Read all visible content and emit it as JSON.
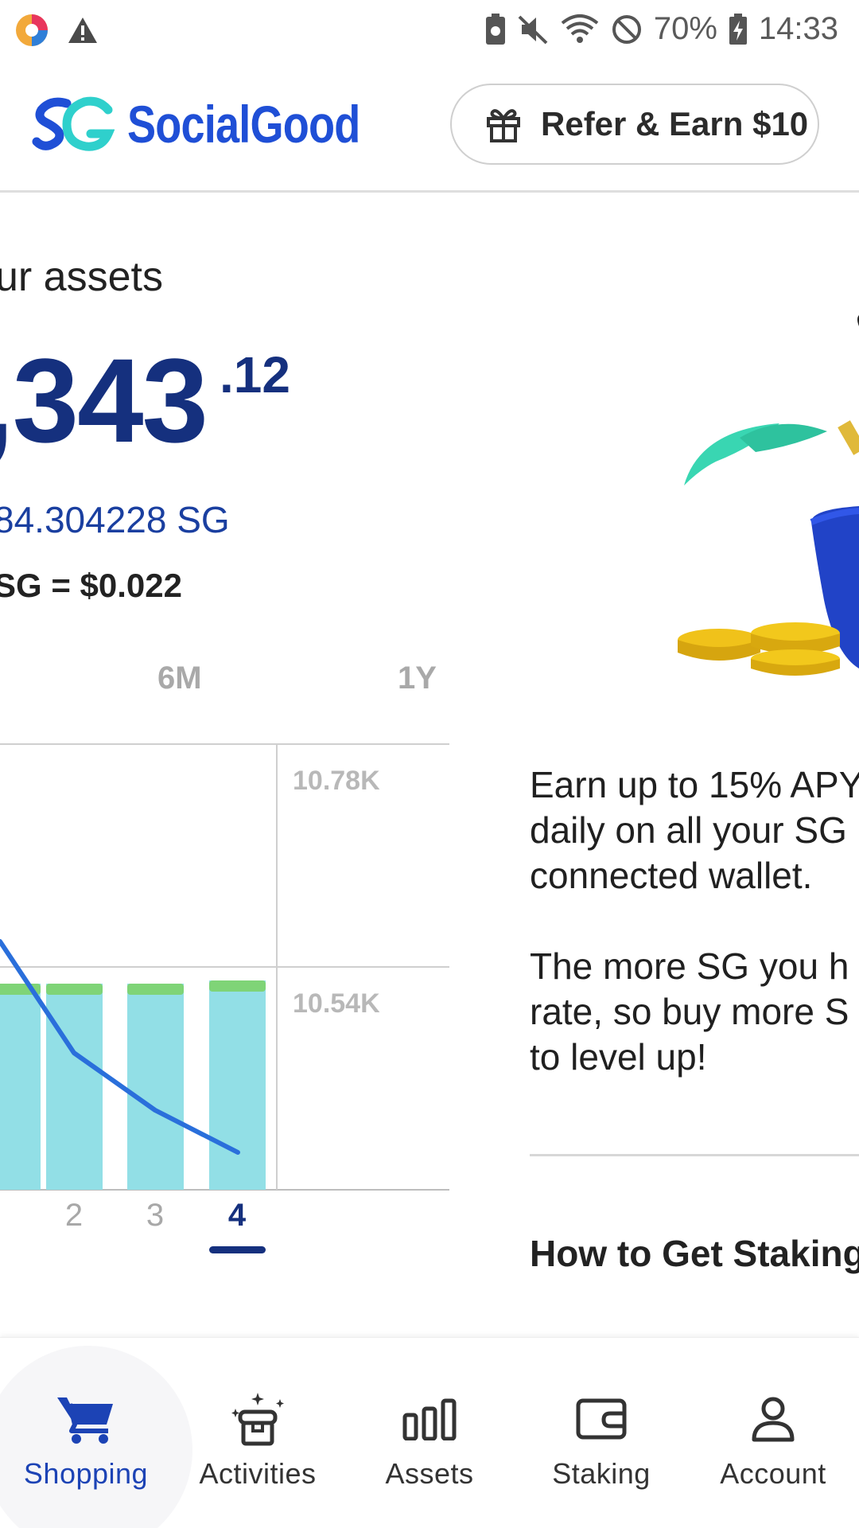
{
  "status_bar": {
    "battery_percent": "70%",
    "time": "14:33",
    "icons": [
      "app-notification-icon",
      "warning-icon",
      "battery-saver-icon",
      "mute-icon",
      "wifi-icon",
      "do-not-disturb-icon",
      "battery-charging-icon"
    ]
  },
  "header": {
    "brand": "SocialGood",
    "refer_label": "Refer & Earn $10",
    "brand_color": "#1f4fd6"
  },
  "assets_card": {
    "title": "ur assets",
    "balance_main": ",343",
    "balance_cents": ".12",
    "sg_amount": "84.304228 SG",
    "sg_rate": "SG = $0.022",
    "range_tabs": [
      "6M",
      "1Y"
    ],
    "accent_color": "#15307e"
  },
  "chart_data": {
    "type": "bar",
    "categories": [
      "",
      "2",
      "3",
      "4"
    ],
    "selected_category": "4",
    "y_tick_labels": [
      "10.78K",
      "10.54K"
    ],
    "series": [
      {
        "type": "bar",
        "color": "#92dfe6",
        "cap_color": "#7fd477"
      },
      {
        "type": "line",
        "color": "#2a6fdb"
      }
    ]
  },
  "staking_card": {
    "paragraph1_lines": [
      "Earn up to 15% APY",
      "daily on all your SG",
      "connected wallet."
    ],
    "paragraph2_lines": [
      "The more SG you h",
      "rate, so buy more S",
      "to level up!"
    ],
    "howto_title": "How to Get Staking"
  },
  "bottom_nav": {
    "items": [
      {
        "label": "Shopping",
        "icon": "cart-icon",
        "active": true
      },
      {
        "label": "Activities",
        "icon": "activities-box-icon",
        "active": false
      },
      {
        "label": "Assets",
        "icon": "bar-chart-icon",
        "active": false
      },
      {
        "label": "Staking",
        "icon": "wallet-icon",
        "active": false
      },
      {
        "label": "Account",
        "icon": "person-icon",
        "active": false
      }
    ],
    "active_color": "#1c43b5"
  }
}
